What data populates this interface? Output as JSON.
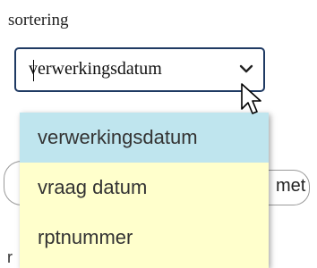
{
  "sort": {
    "label": "sortering",
    "selected_value": "verwerkingsdatum",
    "options": [
      {
        "label": "verwerkingsdatum",
        "selected": true
      },
      {
        "label": "vraag datum",
        "selected": false
      },
      {
        "label": "rptnummer",
        "selected": false
      }
    ]
  },
  "background": {
    "pill_right_text": "met",
    "partial_text": "r"
  },
  "colors": {
    "dropdown_bg": "#ffffcc",
    "selected_option_bg": "#bfe5ee",
    "select_border": "#1f3a63"
  }
}
